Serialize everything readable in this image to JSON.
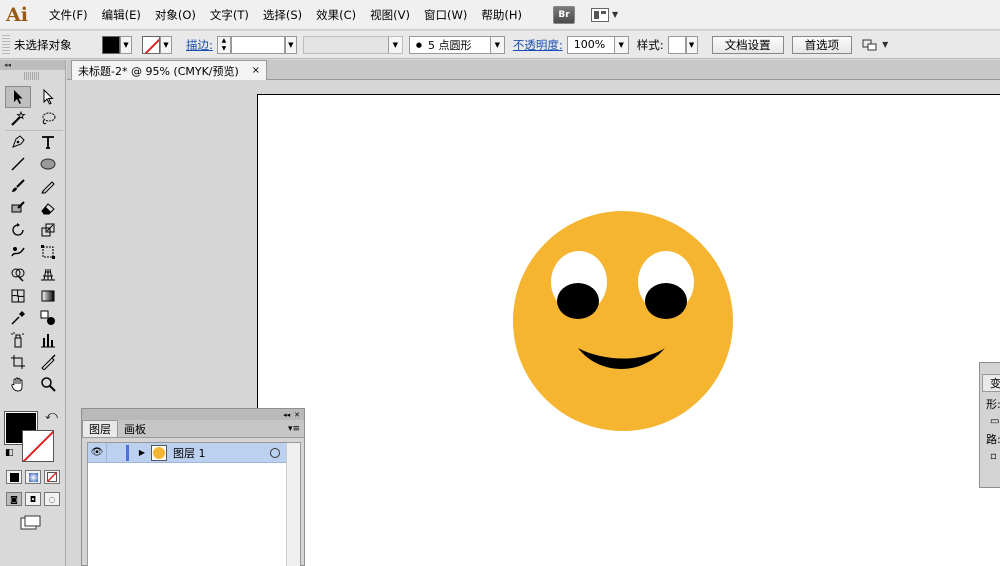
{
  "app": {
    "logo": "Ai",
    "menus": [
      "文件(F)",
      "编辑(E)",
      "对象(O)",
      "文字(T)",
      "选择(S)",
      "效果(C)",
      "视图(V)",
      "窗口(W)",
      "帮助(H)"
    ],
    "bridge_label": "Br"
  },
  "control": {
    "selection_label": "未选择对象",
    "stroke_label": "描边:",
    "brush_label": "5 点圆形",
    "opacity_label": "不透明度:",
    "opacity_value": "100%",
    "style_label": "样式:",
    "doc_setup_button": "文档设置",
    "preferences_button": "首选项"
  },
  "document": {
    "tab_title": "未标题-2* @ 95% (CMYK/预览)",
    "close_glyph": "×"
  },
  "artwork": {
    "face_color": "#F5B530",
    "eye_white": "#FFFFFF",
    "pupil_color": "#000000"
  },
  "layers_panel": {
    "tabs": [
      "图层",
      "画板"
    ],
    "layers": [
      {
        "name": "图层 1",
        "visible": true,
        "selected": true
      }
    ]
  },
  "transform_panel": {
    "tab_label": "变",
    "line1": "形:",
    "line2": "路:"
  },
  "colors": {
    "fill": "#000000",
    "stroke_none_slash": "#DD2222",
    "layer_highlight": "#BCD1EF",
    "layer_color_bar": "#4C72E0"
  }
}
